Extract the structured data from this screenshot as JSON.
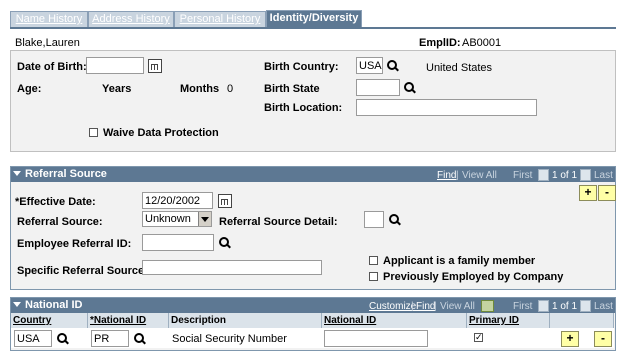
{
  "tabs": [
    "Name History",
    "Address History",
    "Personal History",
    "Identity/Diversity"
  ],
  "header": {
    "name": "Blake,Lauren",
    "emplid_label": "EmplID:",
    "emplid_value": "AB0001"
  },
  "personal": {
    "dob_label": "Date of Birth:",
    "age_label": "Age:",
    "years_label": "Years",
    "months_label": "Months",
    "months_value": "0",
    "birth_country_label": "Birth Country:",
    "birth_country_value": "USA",
    "birth_country_desc": "United States",
    "birth_state_label": "Birth State",
    "birth_location_label": "Birth Location:",
    "waive_label": "Waive Data Protection"
  },
  "referral": {
    "title": "Referral Source",
    "find": "Find",
    "view_all": "View All",
    "first": "First",
    "count": "1 of 1",
    "last": "Last",
    "effective_label": "*Effective Date:",
    "effective_value": "12/20/2002",
    "source_label": "Referral Source:",
    "source_value": "Unknown",
    "detail_label": "Referral Source Detail:",
    "employee_label": "Employee Referral ID:",
    "specific_label": "Specific Referral Source:",
    "family_label": "Applicant is a family member",
    "prev_label": "Previously Employed by Company",
    "add": "+",
    "remove": "-"
  },
  "national_id": {
    "title": "National ID",
    "customize": "Customize",
    "find": "Find",
    "view_all": "View All",
    "first": "First",
    "count": "1 of 1",
    "last": "Last",
    "columns": [
      "Country",
      "*National ID Type",
      "Description",
      "National ID",
      "Primary ID"
    ],
    "row": {
      "country": "USA",
      "type": "PR",
      "description": "Social Security Number",
      "primary": true
    },
    "add": "+",
    "remove": "-"
  }
}
